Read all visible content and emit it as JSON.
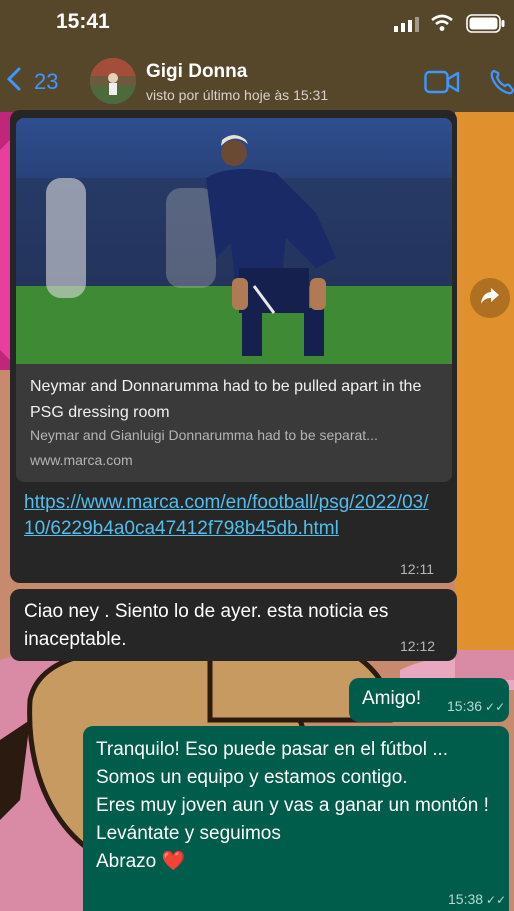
{
  "status_bar": {
    "time": "15:41"
  },
  "header": {
    "back_count": "23",
    "contact_name": "Gigi Donna",
    "last_seen": "visto por último hoje às 15:31"
  },
  "messages": {
    "link_preview": {
      "title": "Neymar and Donnarumma had to be pulled apart in the PSG dressing room",
      "description": "Neymar and Gianluigi Donnarumma had to be separat...",
      "domain": "www.marca.com",
      "url": "https://www.marca.com/en/football/psg/2022/03/10/6229b4a0ca47412f798b45db.html",
      "time": "12:11"
    },
    "incoming_2": {
      "text": "Ciao ney .  Siento lo de ayer.  esta noticia es inaceptable.",
      "time": "12:12"
    },
    "outgoing_1": {
      "text": "Amigo!",
      "time": "15:36",
      "ticks": "✓✓"
    },
    "outgoing_2": {
      "lines": [
        "Tranquilo! Eso puede pasar en el fútbol ...",
        "Somos un equipo y estamos contigo.",
        "Eres muy joven aun y vas a ganar un montón !",
        "Levántate y seguimos",
        "Abrazo"
      ],
      "heart": "❤️",
      "time": "15:38",
      "ticks": "✓✓"
    }
  },
  "colors": {
    "incoming_bubble": "#262626",
    "outgoing_bubble": "#005c4b",
    "link": "#53bdeb",
    "accent": "#3e96ff"
  }
}
